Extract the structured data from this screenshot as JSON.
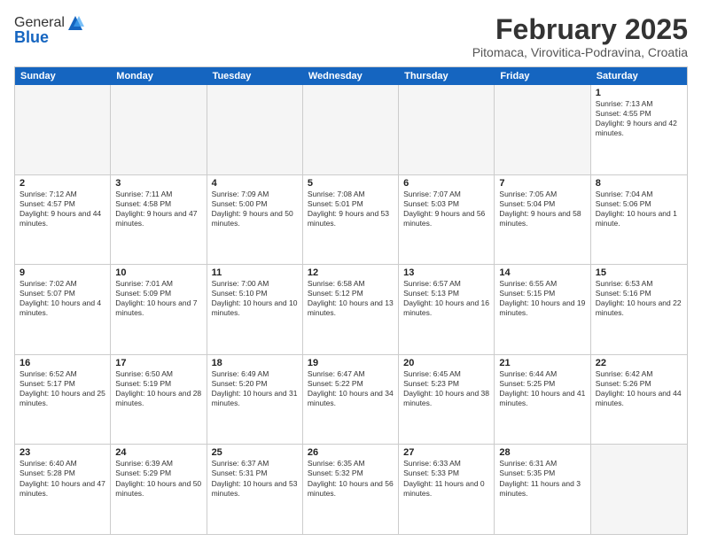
{
  "logo": {
    "general": "General",
    "blue": "Blue"
  },
  "header": {
    "month_year": "February 2025",
    "location": "Pitomaca, Virovitica-Podravina, Croatia"
  },
  "weekdays": [
    "Sunday",
    "Monday",
    "Tuesday",
    "Wednesday",
    "Thursday",
    "Friday",
    "Saturday"
  ],
  "rows": [
    [
      {
        "day": "",
        "info": "",
        "empty": true
      },
      {
        "day": "",
        "info": "",
        "empty": true
      },
      {
        "day": "",
        "info": "",
        "empty": true
      },
      {
        "day": "",
        "info": "",
        "empty": true
      },
      {
        "day": "",
        "info": "",
        "empty": true
      },
      {
        "day": "",
        "info": "",
        "empty": true
      },
      {
        "day": "1",
        "info": "Sunrise: 7:13 AM\nSunset: 4:55 PM\nDaylight: 9 hours and 42 minutes.",
        "empty": false
      }
    ],
    [
      {
        "day": "2",
        "info": "Sunrise: 7:12 AM\nSunset: 4:57 PM\nDaylight: 9 hours and 44 minutes.",
        "empty": false
      },
      {
        "day": "3",
        "info": "Sunrise: 7:11 AM\nSunset: 4:58 PM\nDaylight: 9 hours and 47 minutes.",
        "empty": false
      },
      {
        "day": "4",
        "info": "Sunrise: 7:09 AM\nSunset: 5:00 PM\nDaylight: 9 hours and 50 minutes.",
        "empty": false
      },
      {
        "day": "5",
        "info": "Sunrise: 7:08 AM\nSunset: 5:01 PM\nDaylight: 9 hours and 53 minutes.",
        "empty": false
      },
      {
        "day": "6",
        "info": "Sunrise: 7:07 AM\nSunset: 5:03 PM\nDaylight: 9 hours and 56 minutes.",
        "empty": false
      },
      {
        "day": "7",
        "info": "Sunrise: 7:05 AM\nSunset: 5:04 PM\nDaylight: 9 hours and 58 minutes.",
        "empty": false
      },
      {
        "day": "8",
        "info": "Sunrise: 7:04 AM\nSunset: 5:06 PM\nDaylight: 10 hours and 1 minute.",
        "empty": false
      }
    ],
    [
      {
        "day": "9",
        "info": "Sunrise: 7:02 AM\nSunset: 5:07 PM\nDaylight: 10 hours and 4 minutes.",
        "empty": false
      },
      {
        "day": "10",
        "info": "Sunrise: 7:01 AM\nSunset: 5:09 PM\nDaylight: 10 hours and 7 minutes.",
        "empty": false
      },
      {
        "day": "11",
        "info": "Sunrise: 7:00 AM\nSunset: 5:10 PM\nDaylight: 10 hours and 10 minutes.",
        "empty": false
      },
      {
        "day": "12",
        "info": "Sunrise: 6:58 AM\nSunset: 5:12 PM\nDaylight: 10 hours and 13 minutes.",
        "empty": false
      },
      {
        "day": "13",
        "info": "Sunrise: 6:57 AM\nSunset: 5:13 PM\nDaylight: 10 hours and 16 minutes.",
        "empty": false
      },
      {
        "day": "14",
        "info": "Sunrise: 6:55 AM\nSunset: 5:15 PM\nDaylight: 10 hours and 19 minutes.",
        "empty": false
      },
      {
        "day": "15",
        "info": "Sunrise: 6:53 AM\nSunset: 5:16 PM\nDaylight: 10 hours and 22 minutes.",
        "empty": false
      }
    ],
    [
      {
        "day": "16",
        "info": "Sunrise: 6:52 AM\nSunset: 5:17 PM\nDaylight: 10 hours and 25 minutes.",
        "empty": false
      },
      {
        "day": "17",
        "info": "Sunrise: 6:50 AM\nSunset: 5:19 PM\nDaylight: 10 hours and 28 minutes.",
        "empty": false
      },
      {
        "day": "18",
        "info": "Sunrise: 6:49 AM\nSunset: 5:20 PM\nDaylight: 10 hours and 31 minutes.",
        "empty": false
      },
      {
        "day": "19",
        "info": "Sunrise: 6:47 AM\nSunset: 5:22 PM\nDaylight: 10 hours and 34 minutes.",
        "empty": false
      },
      {
        "day": "20",
        "info": "Sunrise: 6:45 AM\nSunset: 5:23 PM\nDaylight: 10 hours and 38 minutes.",
        "empty": false
      },
      {
        "day": "21",
        "info": "Sunrise: 6:44 AM\nSunset: 5:25 PM\nDaylight: 10 hours and 41 minutes.",
        "empty": false
      },
      {
        "day": "22",
        "info": "Sunrise: 6:42 AM\nSunset: 5:26 PM\nDaylight: 10 hours and 44 minutes.",
        "empty": false
      }
    ],
    [
      {
        "day": "23",
        "info": "Sunrise: 6:40 AM\nSunset: 5:28 PM\nDaylight: 10 hours and 47 minutes.",
        "empty": false
      },
      {
        "day": "24",
        "info": "Sunrise: 6:39 AM\nSunset: 5:29 PM\nDaylight: 10 hours and 50 minutes.",
        "empty": false
      },
      {
        "day": "25",
        "info": "Sunrise: 6:37 AM\nSunset: 5:31 PM\nDaylight: 10 hours and 53 minutes.",
        "empty": false
      },
      {
        "day": "26",
        "info": "Sunrise: 6:35 AM\nSunset: 5:32 PM\nDaylight: 10 hours and 56 minutes.",
        "empty": false
      },
      {
        "day": "27",
        "info": "Sunrise: 6:33 AM\nSunset: 5:33 PM\nDaylight: 11 hours and 0 minutes.",
        "empty": false
      },
      {
        "day": "28",
        "info": "Sunrise: 6:31 AM\nSunset: 5:35 PM\nDaylight: 11 hours and 3 minutes.",
        "empty": false
      },
      {
        "day": "",
        "info": "",
        "empty": true
      }
    ]
  ]
}
